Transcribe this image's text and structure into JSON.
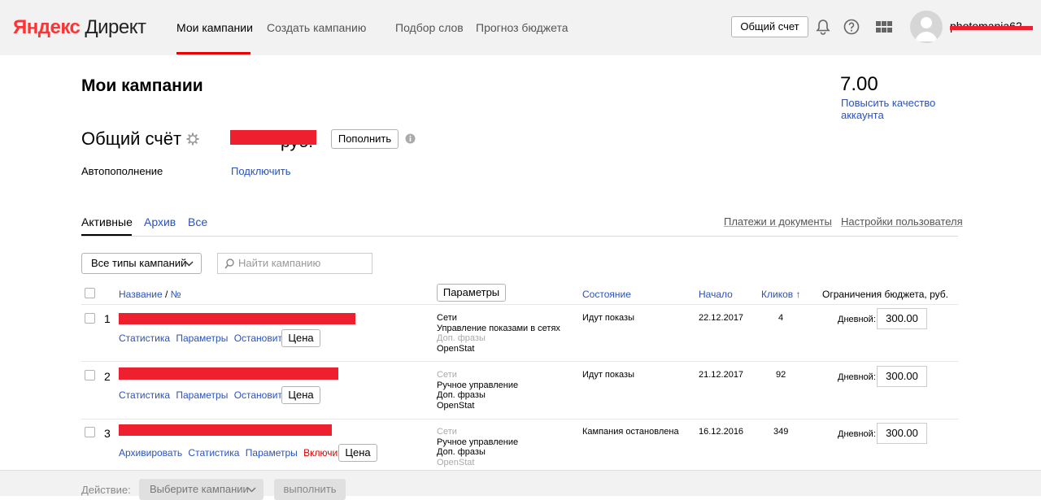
{
  "header": {
    "logo_brand": "Яндекс",
    "logo_product": "Директ",
    "nav": [
      "Мои кампании",
      "Создать кампанию",
      "Подбор слов",
      "Прогноз бюджета"
    ],
    "common_account_button": "Общий счет",
    "username": "photomania62",
    "icons": [
      "bell-icon",
      "help-icon",
      "apps-grid-icon",
      "avatar"
    ]
  },
  "page": {
    "title": "Мои кампании",
    "quality_score": "7.00",
    "quality_link": "Повысить качество аккаунта",
    "account_title": "Общий счёт",
    "account_balance_currency": "руб.",
    "topup_button": "Пополнить",
    "autopay_label": "Автопополнение",
    "autopay_link": "Подключить"
  },
  "tabs": {
    "items": [
      "Активные",
      "Архив",
      "Все"
    ],
    "active": "Активные",
    "right_links": [
      "Платежи и документы",
      "Настройки пользователя"
    ]
  },
  "filters": {
    "type_select": "Все типы кампаний",
    "search_placeholder": "Найти кампанию"
  },
  "table": {
    "columns": {
      "name": "Название",
      "num": "№",
      "params_button": "Параметры",
      "state": "Состояние",
      "start": "Начало",
      "clicks": "Кликов ↑",
      "budget": "Ограничения бюджета, руб."
    },
    "rows": [
      {
        "num": "1",
        "actions": [
          "Статистика",
          "Параметры",
          "Остановить"
        ],
        "price_button": "Цена",
        "strategy": [
          {
            "text": "Сети",
            "muted": false
          },
          {
            "text": "Управление показами в сетях",
            "muted": false
          },
          {
            "text": "Доп. фразы",
            "muted": true
          },
          {
            "text": "OpenStat",
            "muted": false
          }
        ],
        "state": "Идут показы",
        "start": "22.12.2017",
        "clicks": "4",
        "daily_label": "Дневной:",
        "budget": "300.00"
      },
      {
        "num": "2",
        "actions": [
          "Статистика",
          "Параметры",
          "Остановить"
        ],
        "price_button": "Цена",
        "strategy": [
          {
            "text": "Сети",
            "muted": true
          },
          {
            "text": "Ручное управление",
            "muted": false
          },
          {
            "text": "Доп. фразы",
            "muted": false
          },
          {
            "text": "OpenStat",
            "muted": false
          }
        ],
        "state": "Идут показы",
        "start": "21.12.2017",
        "clicks": "92",
        "daily_label": "Дневной:",
        "budget": "300.00"
      },
      {
        "num": "3",
        "actions": [
          "Архивировать",
          "Статистика",
          "Параметры",
          "Включить"
        ],
        "price_button": "Цена",
        "strategy": [
          {
            "text": "Сети",
            "muted": true
          },
          {
            "text": "Ручное управление",
            "muted": false
          },
          {
            "text": "Доп. фразы",
            "muted": false
          },
          {
            "text": "OpenStat",
            "muted": true
          }
        ],
        "state": "Кампания остановлена",
        "start": "16.12.2016",
        "clicks": "349",
        "daily_label": "Дневной:",
        "budget": "300.00"
      }
    ]
  },
  "footer": {
    "label": "Действие:",
    "select": "Выберите кампании",
    "submit": "выполнить"
  },
  "colors": {
    "link": "#2a52be",
    "accent_red": "#ee1f2f",
    "header_bg": "#f2f2f2"
  }
}
